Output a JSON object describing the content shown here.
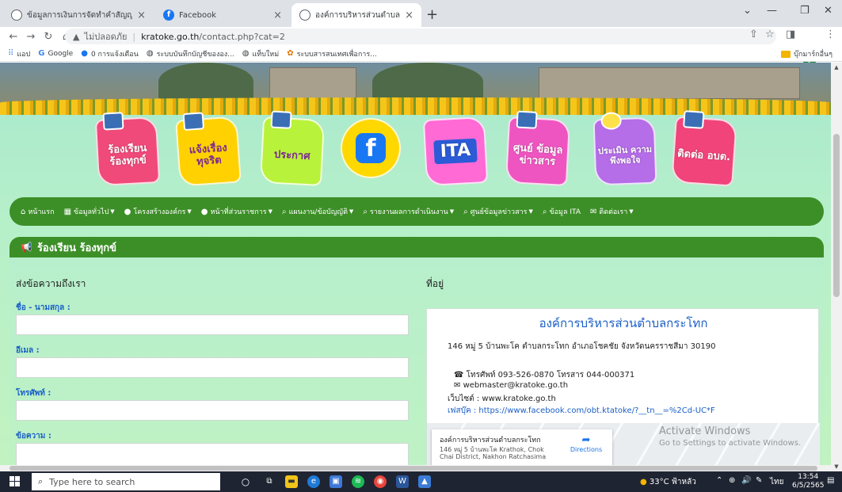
{
  "browser": {
    "tabs": [
      {
        "title": "ข้อมูลการเงินการจัดทำคำสัญญาที่สั่ง/"
      },
      {
        "title": "Facebook"
      },
      {
        "title": "องค์การบริหารส่วนตำบลกระโทก"
      }
    ],
    "address": {
      "security": "ไม่ปลอดภัย",
      "host": "kratoke.go.th",
      "path": "/contact.php?cat=2",
      "profile_letter": "t"
    },
    "bookmarks": [
      {
        "label": "แอป"
      },
      {
        "label": "Google"
      },
      {
        "label": "0 การแจ้งเตือน"
      },
      {
        "label": "ระบบบันทึกบัญชีขององ..."
      },
      {
        "label": "แท็บใหม่"
      },
      {
        "label": "ระบบสารสนเทศเพื่อการ..."
      }
    ],
    "other_bookmarks": "บุ๊กมาร์กอื่นๆ"
  },
  "site": {
    "buttons": [
      {
        "label": "ร้องเรียน ร้องทุกข์"
      },
      {
        "label": "แจ้งเรื่อง ทุจริต"
      },
      {
        "label": "ประกาศ"
      },
      {
        "label": "f"
      },
      {
        "label": "ITA"
      },
      {
        "label": "ศูนย์ ข้อมูล ข่าวสาร"
      },
      {
        "label": "ประเมิน ความ พึงพอใจ"
      },
      {
        "label": "ติดต่อ อบต."
      }
    ],
    "menu": [
      {
        "label": "หน้าแรก"
      },
      {
        "label": "ข้อมูลทั่วไป"
      },
      {
        "label": "โครงสร้างองค์กร"
      },
      {
        "label": "หน้าที่ส่วนราชการ"
      },
      {
        "label": "แผนงาน/ข้อบัญญัติ"
      },
      {
        "label": "รายงานผลการดำเนินงาน"
      },
      {
        "label": "ศูนย์ข้อมูลข่าวสาร"
      },
      {
        "label": "ข้อมูล ITA"
      },
      {
        "label": "ติดต่อเรา"
      }
    ],
    "section_title": "ร้องเรียน ร้องทุกข์",
    "form": {
      "heading": "ส่งข้อความถึงเรา",
      "fields": [
        {
          "label": "ชื่อ - นามสกุล :",
          "value": ""
        },
        {
          "label": "อีเมล :",
          "value": ""
        },
        {
          "label": "โทรศัพท์ :",
          "value": ""
        },
        {
          "label": "ข้อความ :",
          "value": ""
        }
      ]
    },
    "address": {
      "heading": "ที่อยู่",
      "org": "องค์การบริหารส่วนตำบลกระโทก",
      "line": "146 หมู่ 5 บ้านพะโค ตำบลกระโทก อำเภอโชคชัย จังหวัดนครราชสีมา 30190",
      "phone": "โทรศัพท์ 093-526-0870 โทรสาร 044-000371",
      "email": "webmaster@kratoke.go.th",
      "website": "เว็บไซต์ : www.kratoke.go.th",
      "facebook": "เฟสบุ๊ค : https://www.facebook.com/obt.ktatoke/?__tn__=%2Cd-UC*F",
      "map": {
        "name": "องค์การบริหารส่วนตำบลกระโทก",
        "addr": "146 หมู่ 5 บ้านพะโค Krathok, Chok Chai District, Nakhon Ratchasima",
        "directions": "Directions"
      }
    }
  },
  "watermark": {
    "line1": "Activate Windows",
    "line2": "Go to Settings to activate Windows."
  },
  "taskbar": {
    "search_placeholder": "Type here to search",
    "weather": "33°C ฟ้าหลัว",
    "lang": "ไทย",
    "time": "13:54",
    "date": "6/5/2565"
  }
}
